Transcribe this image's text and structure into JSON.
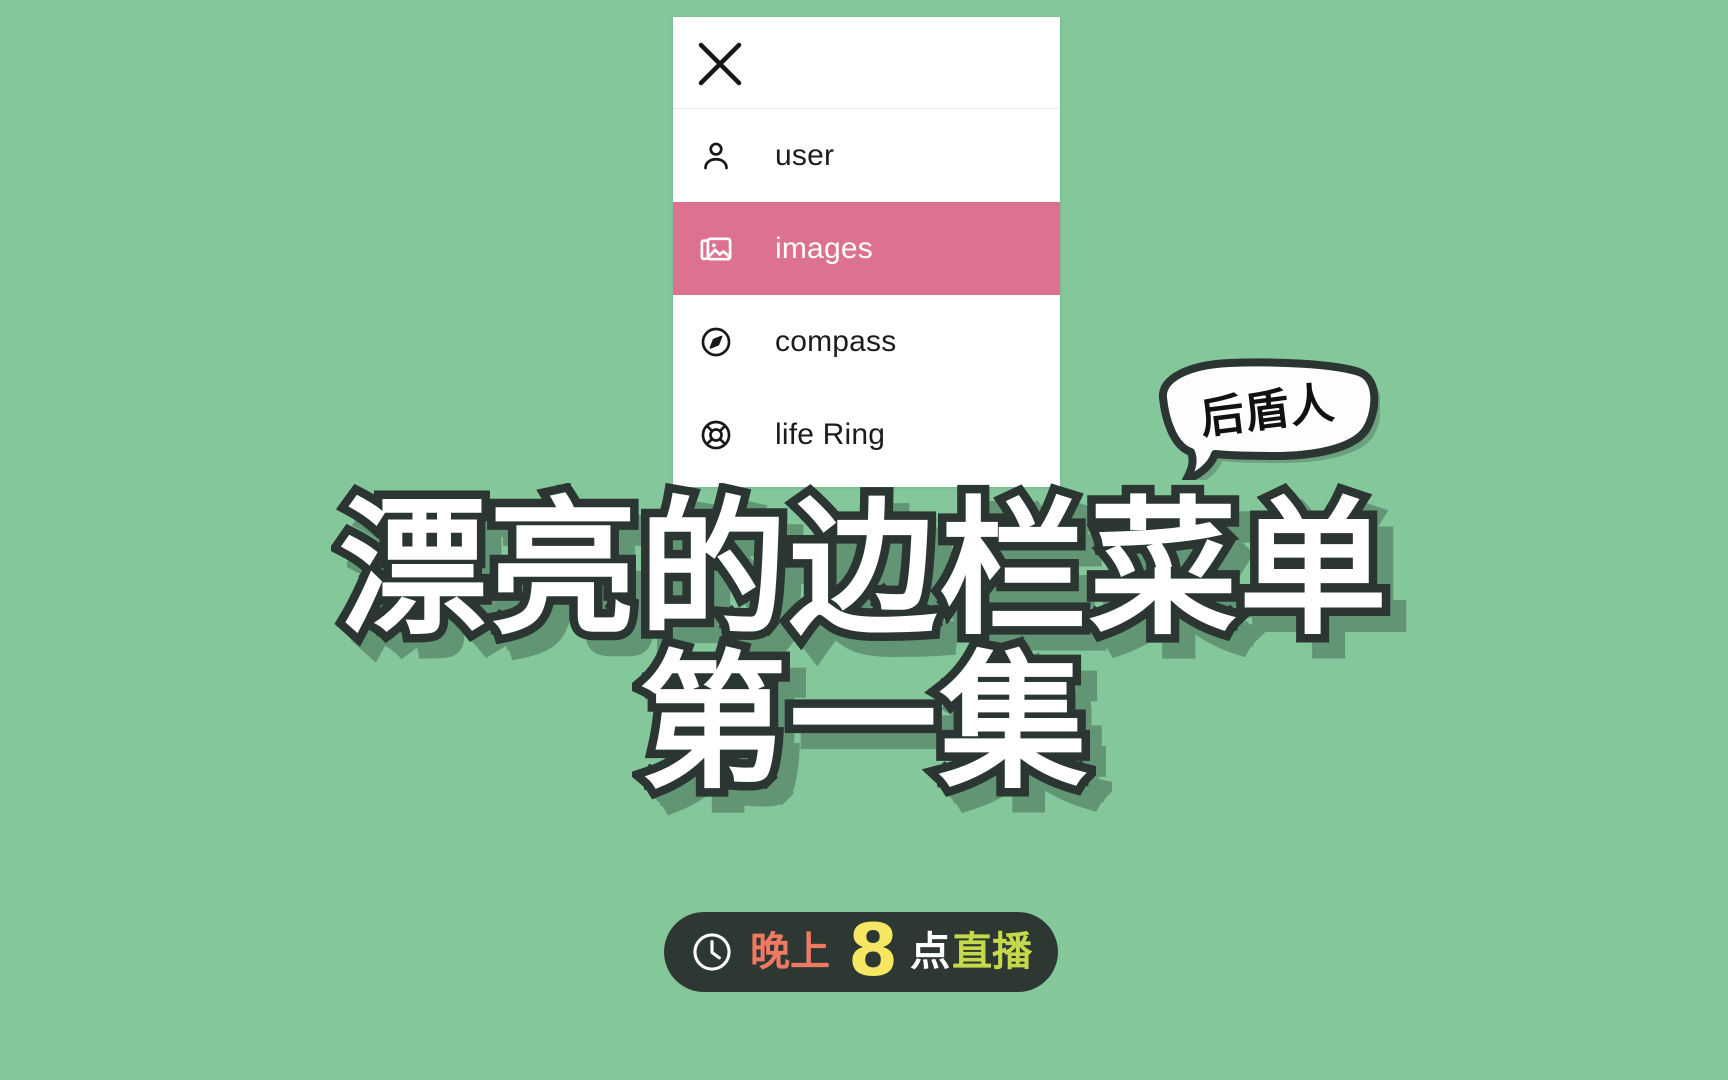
{
  "theme": {
    "background_color": "#84c79b",
    "panel_color": "#ffffff",
    "active_item_color": "#dd7290",
    "title_fill": "#ffffff",
    "title_outline": "#2b3632",
    "badge_background": "#2e3833"
  },
  "menu": {
    "close_icon": "close-icon",
    "items": [
      {
        "icon": "user-icon",
        "label": "user",
        "active": false
      },
      {
        "icon": "images-icon",
        "label": "images",
        "active": true
      },
      {
        "icon": "compass-icon",
        "label": "compass",
        "active": false
      },
      {
        "icon": "life-ring-icon",
        "label": "life Ring",
        "active": false
      }
    ]
  },
  "speech_bubble": {
    "text": "后盾人"
  },
  "title": {
    "line1": "漂亮的边栏菜单",
    "line2": "第一集"
  },
  "live_badge": {
    "clock_icon": "clock-icon",
    "evening": "晚上",
    "hour": "8",
    "oclock": "点",
    "live": "直播",
    "evening_color": "#ee7a63",
    "hour_color": "#f7e663",
    "oclock_color": "#ffffff",
    "live_color": "#c5d94a"
  }
}
